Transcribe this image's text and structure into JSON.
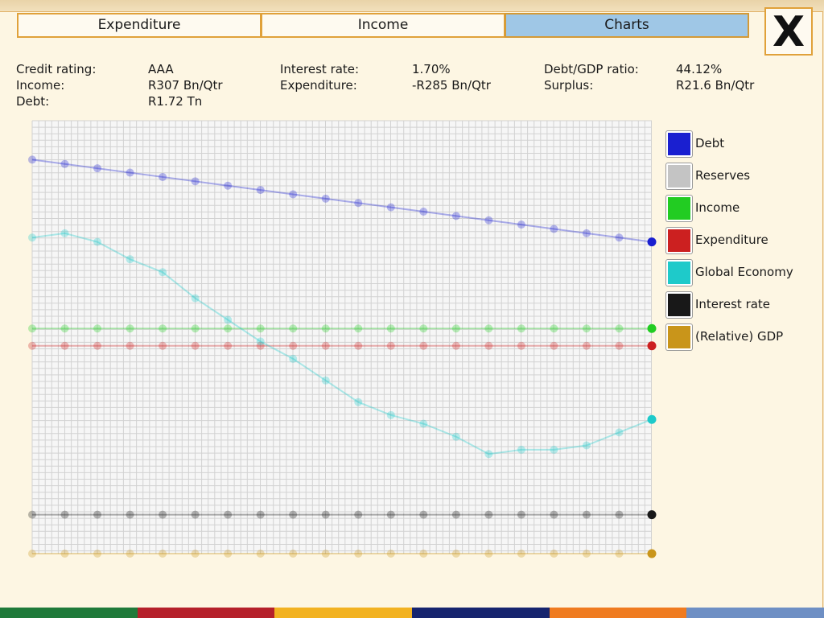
{
  "tabs": [
    {
      "label": "Expenditure",
      "active": false
    },
    {
      "label": "Income",
      "active": false
    },
    {
      "label": "Charts",
      "active": true
    }
  ],
  "close_label": "X",
  "stats": [
    {
      "label": "Credit rating:",
      "value": "AAA"
    },
    {
      "label": "Income:",
      "value": "R307 Bn/Qtr"
    },
    {
      "label": "Debt:",
      "value": "R1.72 Tn"
    },
    {
      "label": "Interest rate:",
      "value": "1.70%"
    },
    {
      "label": "Expenditure:",
      "value": "-R285 Bn/Qtr"
    },
    {
      "label": "Debt/GDP ratio:",
      "value": "44.12%"
    },
    {
      "label": "Surplus:",
      "value": "R21.6 Bn/Qtr"
    }
  ],
  "chart_data": {
    "type": "line",
    "x": [
      1,
      2,
      3,
      4,
      5,
      6,
      7,
      8,
      9,
      10,
      11,
      12,
      13,
      14,
      15,
      16,
      17,
      18,
      19,
      20
    ],
    "ylim": [
      0,
      1
    ],
    "grid": true,
    "legend_position": "right",
    "series": [
      {
        "name": "Debt",
        "color": "#1a1fd0",
        "values": [
          0.91,
          0.9,
          0.89,
          0.88,
          0.87,
          0.86,
          0.85,
          0.84,
          0.83,
          0.82,
          0.81,
          0.8,
          0.79,
          0.78,
          0.77,
          0.76,
          0.75,
          0.74,
          0.73,
          0.72
        ]
      },
      {
        "name": "Reserves",
        "color": "#c4c4c4",
        "values": []
      },
      {
        "name": "Income",
        "color": "#22cc22",
        "values": [
          0.52,
          0.52,
          0.52,
          0.52,
          0.52,
          0.52,
          0.52,
          0.52,
          0.52,
          0.52,
          0.52,
          0.52,
          0.52,
          0.52,
          0.52,
          0.52,
          0.52,
          0.52,
          0.52,
          0.52
        ]
      },
      {
        "name": "Expenditure",
        "color": "#cc2020",
        "values": [
          0.48,
          0.48,
          0.48,
          0.48,
          0.48,
          0.48,
          0.48,
          0.48,
          0.48,
          0.48,
          0.48,
          0.48,
          0.48,
          0.48,
          0.48,
          0.48,
          0.48,
          0.48,
          0.48,
          0.48
        ]
      },
      {
        "name": "Global Economy",
        "color": "#1ecaca",
        "values": [
          0.73,
          0.74,
          0.72,
          0.68,
          0.65,
          0.59,
          0.54,
          0.49,
          0.45,
          0.4,
          0.35,
          0.32,
          0.3,
          0.27,
          0.23,
          0.24,
          0.24,
          0.25,
          0.28,
          0.31
        ]
      },
      {
        "name": "Interest rate",
        "color": "#181818",
        "values": [
          0.09,
          0.09,
          0.09,
          0.09,
          0.09,
          0.09,
          0.09,
          0.09,
          0.09,
          0.09,
          0.09,
          0.09,
          0.09,
          0.09,
          0.09,
          0.09,
          0.09,
          0.09,
          0.09,
          0.09
        ]
      },
      {
        "name": "(Relative) GDP",
        "color": "#c9951a",
        "values": [
          0.0,
          0.0,
          0.0,
          0.0,
          0.0,
          0.0,
          0.0,
          0.0,
          0.0,
          0.0,
          0.0,
          0.0,
          0.0,
          0.0,
          0.0,
          0.0,
          0.0,
          0.0,
          0.0,
          0.0
        ]
      }
    ]
  },
  "colors": {
    "tab_border": "#e0a13a",
    "tab_active": "#9fc7e6",
    "panel_bg": "#fdf6e3"
  },
  "footer_colors": [
    "#1f7a3a",
    "#b5202a",
    "#f2b221",
    "#16246e",
    "#ef7b20",
    "#6e8fc4"
  ]
}
